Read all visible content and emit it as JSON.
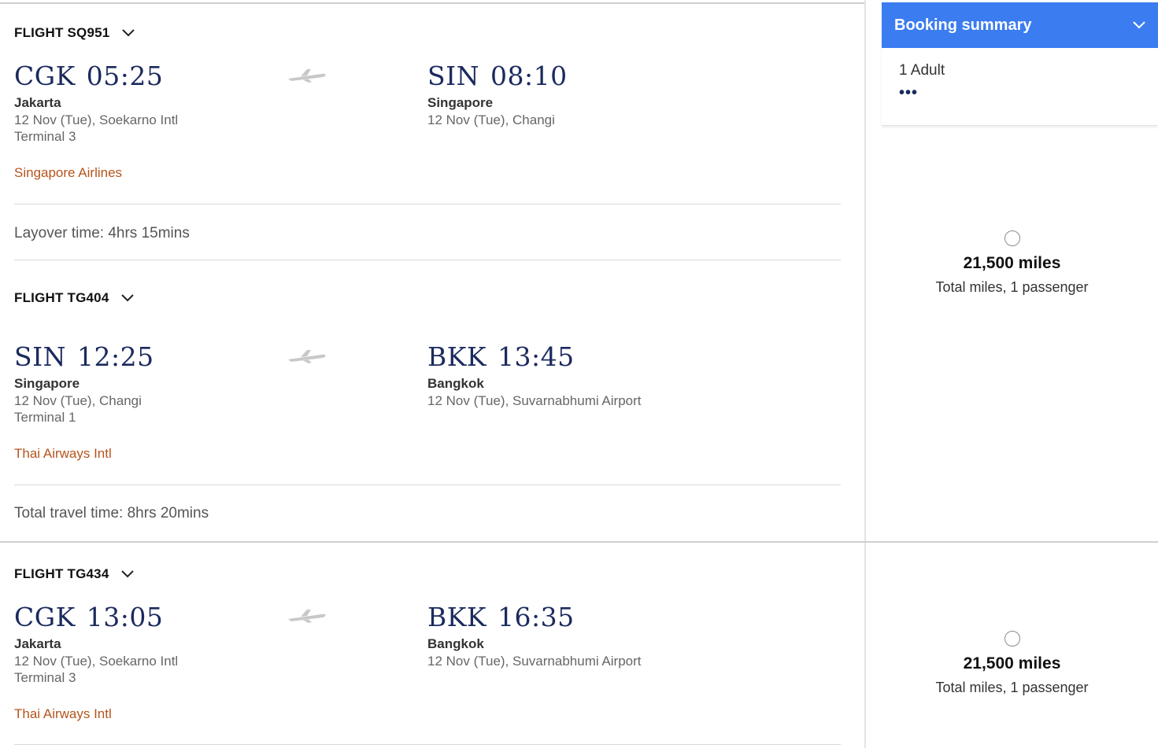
{
  "itinerary1": {
    "flights": [
      {
        "label": "FLIGHT SQ951",
        "departure": {
          "code": "CGK",
          "time": "05:25",
          "city": "Jakarta",
          "date_airport": "12 Nov (Tue), Soekarno Intl",
          "terminal": "Terminal 3"
        },
        "arrival": {
          "code": "SIN",
          "time": "08:10",
          "city": "Singapore",
          "date_airport": "12 Nov (Tue), Changi"
        },
        "airline": "Singapore Airlines"
      },
      {
        "label": "FLIGHT TG404",
        "departure": {
          "code": "SIN",
          "time": "12:25",
          "city": "Singapore",
          "date_airport": "12 Nov (Tue), Changi",
          "terminal": "Terminal 1"
        },
        "arrival": {
          "code": "BKK",
          "time": "13:45",
          "city": "Bangkok",
          "date_airport": "12 Nov (Tue), Suvarnabhumi Airport"
        },
        "airline": "Thai Airways Intl"
      }
    ],
    "layover": "Layover time: 4hrs 15mins",
    "total_travel": "Total travel time: 8hrs 20mins",
    "fare": {
      "miles": "21,500 miles",
      "note": "Total miles, 1 passenger"
    }
  },
  "itinerary2": {
    "flights": [
      {
        "label": "FLIGHT TG434",
        "departure": {
          "code": "CGK",
          "time": "13:05",
          "city": "Jakarta",
          "date_airport": "12 Nov (Tue), Soekarno Intl",
          "terminal": "Terminal 3"
        },
        "arrival": {
          "code": "BKK",
          "time": "16:35",
          "city": "Bangkok",
          "date_airport": "12 Nov (Tue), Suvarnabhumi Airport"
        },
        "airline": "Thai Airways Intl"
      }
    ],
    "fare": {
      "miles": "21,500 miles",
      "note": "Total miles, 1 passenger"
    }
  },
  "booking_summary": {
    "title": "Booking summary",
    "passengers": "1 Adult",
    "more": "•••"
  },
  "colors": {
    "accent": "#3b7cf0",
    "airport_code": "#1b2a5e",
    "airline": "#b5541c"
  },
  "icons": [
    "chevron-down-icon",
    "plane-icon",
    "radio-button-icon"
  ]
}
